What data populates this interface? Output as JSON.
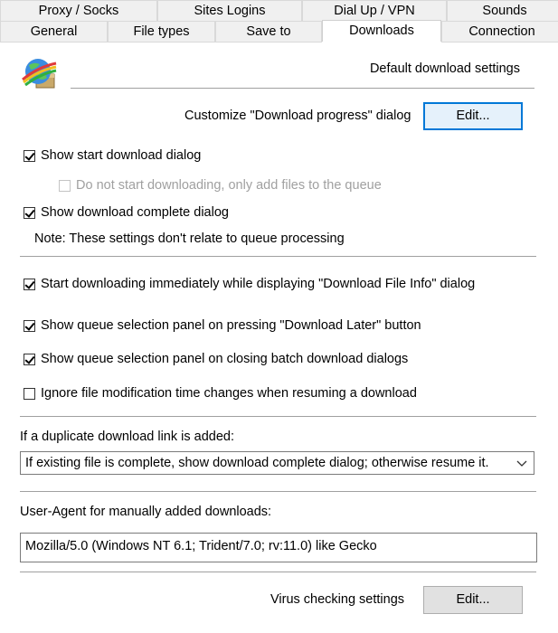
{
  "tabs": {
    "row1": [
      "Proxy / Socks",
      "Sites Logins",
      "Dial Up / VPN",
      "Sounds"
    ],
    "row2": [
      "General",
      "File types",
      "Save to",
      "Downloads",
      "Connection"
    ],
    "active": "Downloads"
  },
  "header": {
    "icon": "app-globe-icon",
    "title": "Default download settings"
  },
  "progress_dialog": {
    "label": "Customize \"Download progress\" dialog",
    "button": "Edit..."
  },
  "checkboxes": {
    "show_start": {
      "label": "Show start download dialog",
      "checked": true
    },
    "do_not_start": {
      "label": "Do not start downloading, only add files to the queue",
      "checked": false,
      "enabled": false
    },
    "show_complete": {
      "label": "Show download complete dialog",
      "checked": true
    },
    "start_immediately": {
      "label": "Start downloading immediately while displaying \"Download File Info\" dialog",
      "checked": true
    },
    "queue_panel_later": {
      "label": "Show queue selection panel on pressing \"Download Later\" button",
      "checked": true
    },
    "queue_panel_batch": {
      "label": "Show queue selection panel on closing batch download dialogs",
      "checked": true
    },
    "ignore_mod_time": {
      "label": "Ignore file modification time changes when resuming a download",
      "checked": false
    }
  },
  "note": "Note: These settings don't relate to queue processing",
  "duplicate": {
    "label": "If a duplicate download link is added:",
    "selected": "If existing file is complete, show download complete dialog; otherwise resume it."
  },
  "user_agent": {
    "label": "User-Agent for manually added downloads:",
    "value": "Mozilla/5.0 (Windows NT 6.1; Trident/7.0; rv:11.0) like Gecko"
  },
  "virus": {
    "label": "Virus checking settings",
    "button": "Edit..."
  },
  "colors": {
    "accent": "#0078d7",
    "tab_bg": "#f0f0f0",
    "separator": "#a0a0a0"
  }
}
